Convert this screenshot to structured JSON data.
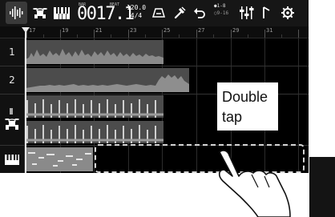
{
  "toolbar": {
    "icons": [
      "audio-track-view-icon",
      "drum-view-icon",
      "keyboard-view-icon",
      "metronome-icon",
      "tools-icon",
      "undo-icon",
      "mixer-icon",
      "pitch-icon",
      "settings-icon"
    ],
    "counter_label": "BAR",
    "beat_label": "BEAT",
    "counter": "0017.1",
    "tempo": "120.0",
    "meter": "4/4",
    "punch_top": "●1-8",
    "punch_bottom": "○9-16"
  },
  "ruler": {
    "bars": [
      "17",
      "19",
      "21",
      "23",
      "25",
      "27",
      "29",
      "31"
    ]
  },
  "tracks": [
    {
      "label": "1"
    },
    {
      "label": "2"
    }
  ],
  "callout": {
    "line1": "Double",
    "line2": "tap"
  }
}
